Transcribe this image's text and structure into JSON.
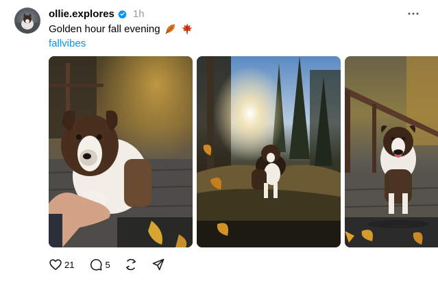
{
  "post": {
    "username": "ollie.explores",
    "time": "1h",
    "caption": "Golden hour fall evening",
    "tag": "fallvibes",
    "emojis": [
      "fallen-leaf-icon",
      "maple-leaf-icon"
    ]
  },
  "actions": {
    "likes": "21",
    "replies": "5"
  },
  "colors": {
    "tag": "#0095f6",
    "verified": "#0095f6",
    "muted": "#999999"
  },
  "images": [
    {
      "name": "dog-paw-in-hand-photo"
    },
    {
      "name": "dog-in-grass-sunset-photo"
    },
    {
      "name": "dog-on-bridge-photo"
    }
  ]
}
